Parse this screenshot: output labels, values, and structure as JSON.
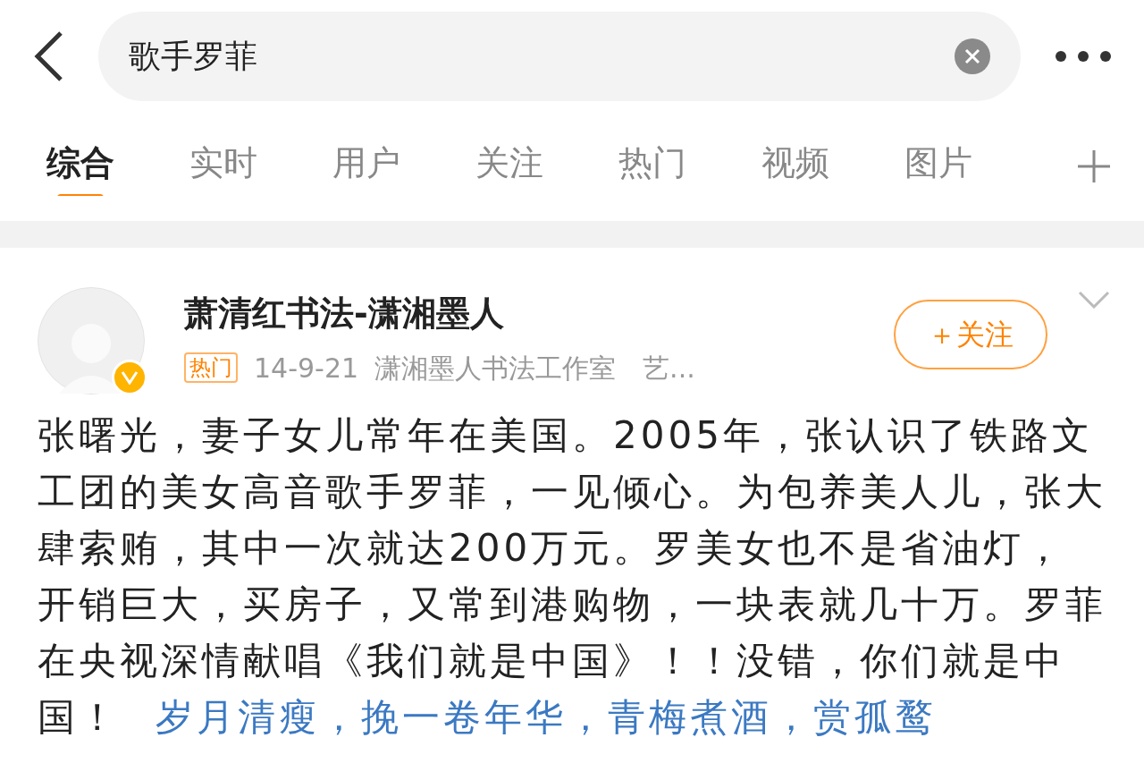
{
  "search": {
    "value": "歌手罗菲"
  },
  "tabs": [
    {
      "label": "综合",
      "selected": true
    },
    {
      "label": "实时",
      "selected": false
    },
    {
      "label": "用户",
      "selected": false
    },
    {
      "label": "关注",
      "selected": false
    },
    {
      "label": "热门",
      "selected": false
    },
    {
      "label": "视频",
      "selected": false
    },
    {
      "label": "图片",
      "selected": false
    }
  ],
  "post": {
    "author": "萧清红书法-潇湘墨人",
    "verified": true,
    "badge": "热门",
    "date": "14-9-21",
    "source": "潇湘墨人书法工作室　艺...",
    "follow_button": "＋关注",
    "text": "张曙光，妻子女儿常年在美国。2005年，张认识了铁路文工团的美女高音歌手罗菲，一见倾心。为包养美人儿，张大肆索贿，其中一次就达200万元。罗美女也不是省油灯，开销巨大，买房子，又常到港购物，一块表就几十万。罗菲在央视深情献唱《我们就是中国》！！没错，你们就是中国！",
    "link": "岁月清瘦，挽一卷年华，青梅煮酒，赏孤鹜"
  }
}
